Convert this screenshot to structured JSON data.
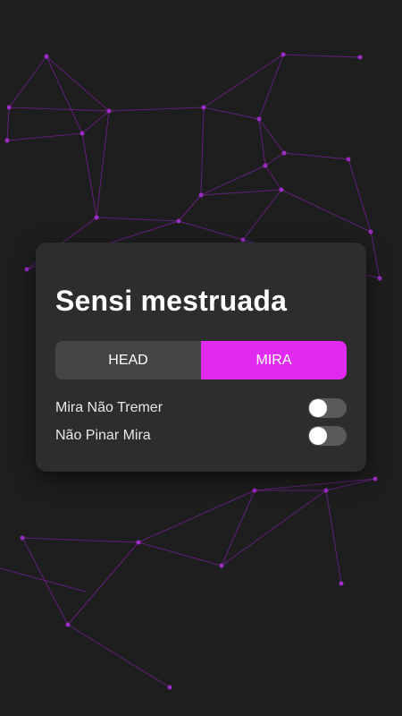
{
  "panel": {
    "title": "Sensi mestruada",
    "tabs": [
      {
        "label": "HEAD",
        "active": false
      },
      {
        "label": "MIRA",
        "active": true
      }
    ],
    "options": [
      {
        "label": "Mira Não Tremer",
        "enabled": false
      },
      {
        "label": "Não Pinar Mira",
        "enabled": false
      }
    ]
  },
  "colors": {
    "background": "#1e1e1e",
    "panel": "#2d2d2d",
    "accent": "#e12af0",
    "network": "#9b2cc4"
  }
}
